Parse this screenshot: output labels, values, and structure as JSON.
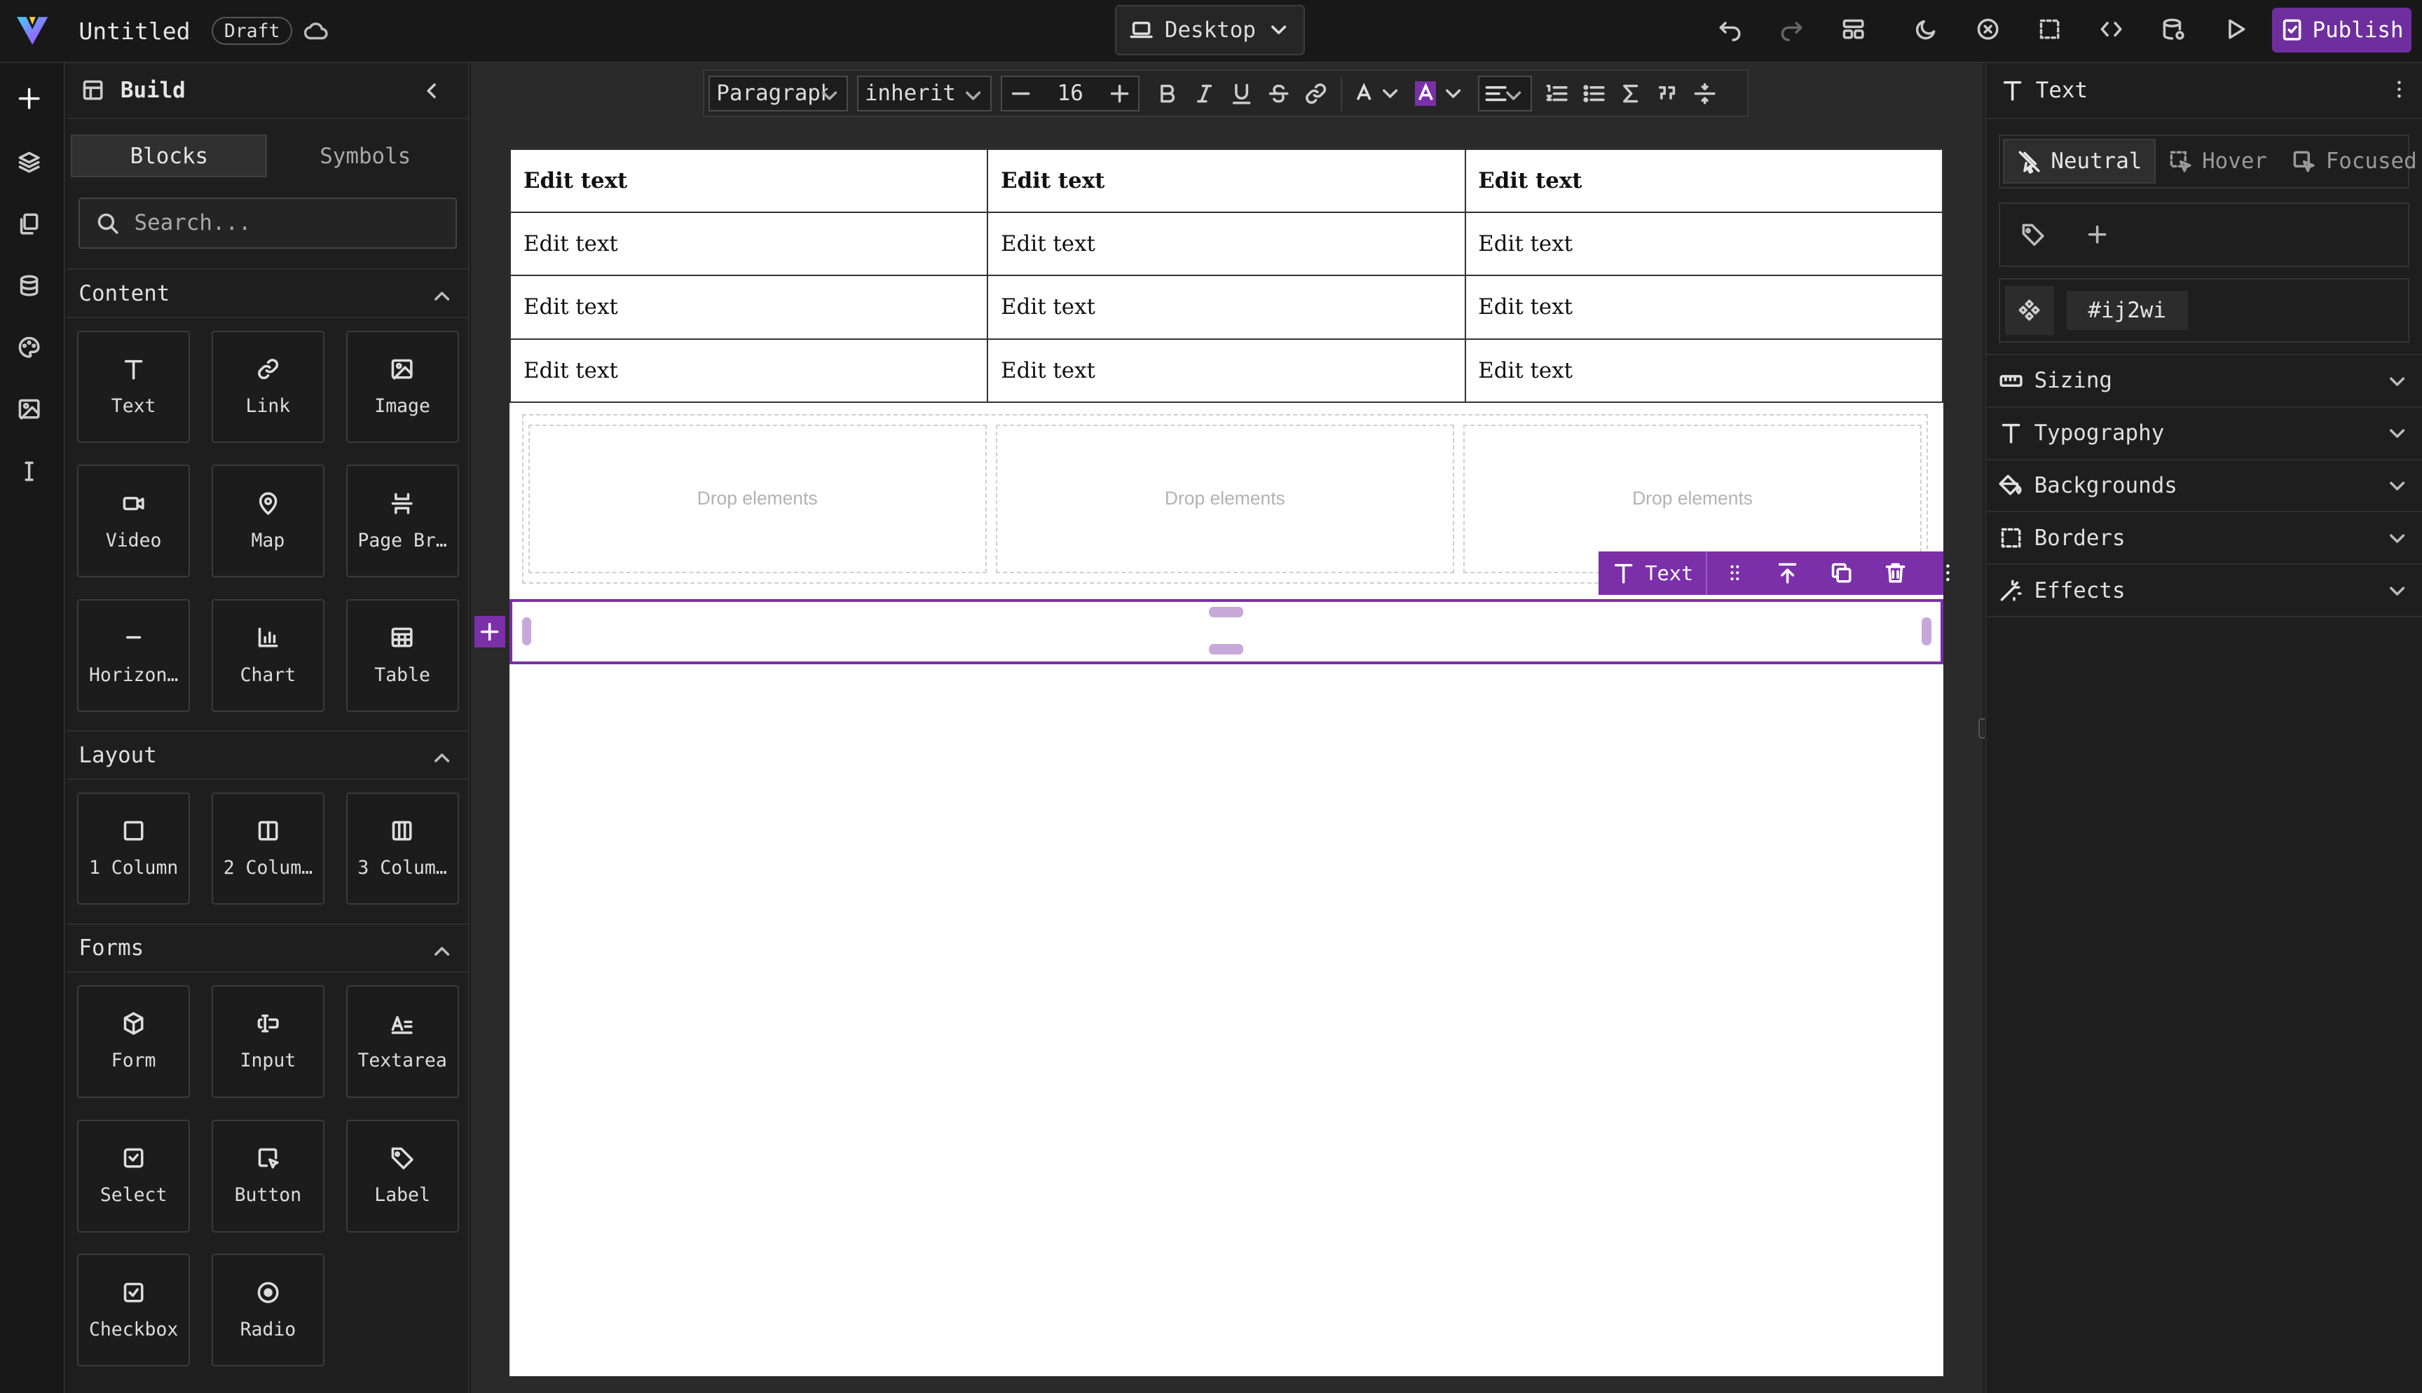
{
  "topbar": {
    "title": "Untitled",
    "status_badge": "Draft",
    "device": "Desktop",
    "publish_label": "Publish"
  },
  "left_panel": {
    "title": "Build",
    "tabs": [
      "Blocks",
      "Symbols"
    ],
    "search_placeholder": "Search...",
    "sections": [
      {
        "title": "Content",
        "blocks": [
          {
            "label": "Text",
            "icon": "text-icon"
          },
          {
            "label": "Link",
            "icon": "link-icon"
          },
          {
            "label": "Image",
            "icon": "image-icon"
          },
          {
            "label": "Video",
            "icon": "video-icon"
          },
          {
            "label": "Map",
            "icon": "map-pin-icon"
          },
          {
            "label": "Page Br…",
            "icon": "page-break-icon"
          },
          {
            "label": "Horizon…",
            "icon": "horizontal-rule-icon"
          },
          {
            "label": "Chart",
            "icon": "chart-icon"
          },
          {
            "label": "Table",
            "icon": "table-icon"
          }
        ]
      },
      {
        "title": "Layout",
        "blocks": [
          {
            "label": "1 Column",
            "icon": "one-column-icon"
          },
          {
            "label": "2 Colum…",
            "icon": "two-column-icon"
          },
          {
            "label": "3 Colum…",
            "icon": "three-column-icon"
          }
        ]
      },
      {
        "title": "Forms",
        "blocks": [
          {
            "label": "Form",
            "icon": "form-icon"
          },
          {
            "label": "Input",
            "icon": "input-icon"
          },
          {
            "label": "Textarea",
            "icon": "textarea-icon"
          },
          {
            "label": "Select",
            "icon": "select-icon"
          },
          {
            "label": "Button",
            "icon": "button-icon"
          },
          {
            "label": "Label",
            "icon": "label-icon"
          },
          {
            "label": "Checkbox",
            "icon": "checkbox-icon"
          },
          {
            "label": "Radio",
            "icon": "radio-icon"
          }
        ]
      }
    ]
  },
  "rte_toolbar": {
    "block_type": "Paragraph",
    "font": "inherit",
    "font_size": "16"
  },
  "canvas": {
    "table": {
      "header": [
        "Edit text",
        "Edit text",
        "Edit text"
      ],
      "rows": [
        [
          "Edit text",
          "Edit text",
          "Edit text"
        ],
        [
          "Edit text",
          "Edit text",
          "Edit text"
        ],
        [
          "Edit text",
          "Edit text",
          "Edit text"
        ]
      ]
    },
    "drop_zones": [
      "Drop elements",
      "Drop elements",
      "Drop elements"
    ],
    "element_toolbar_label": "Text"
  },
  "right_panel": {
    "title": "Text",
    "states": [
      "Neutral",
      "Hover",
      "Focused"
    ],
    "element_id": "#ij2wi",
    "sections": [
      "Sizing",
      "Typography",
      "Backgrounds",
      "Borders",
      "Effects"
    ]
  },
  "colors": {
    "accent": "#7b2fa8",
    "publish": "#6f2e9e",
    "background": "#1a1a1a"
  }
}
